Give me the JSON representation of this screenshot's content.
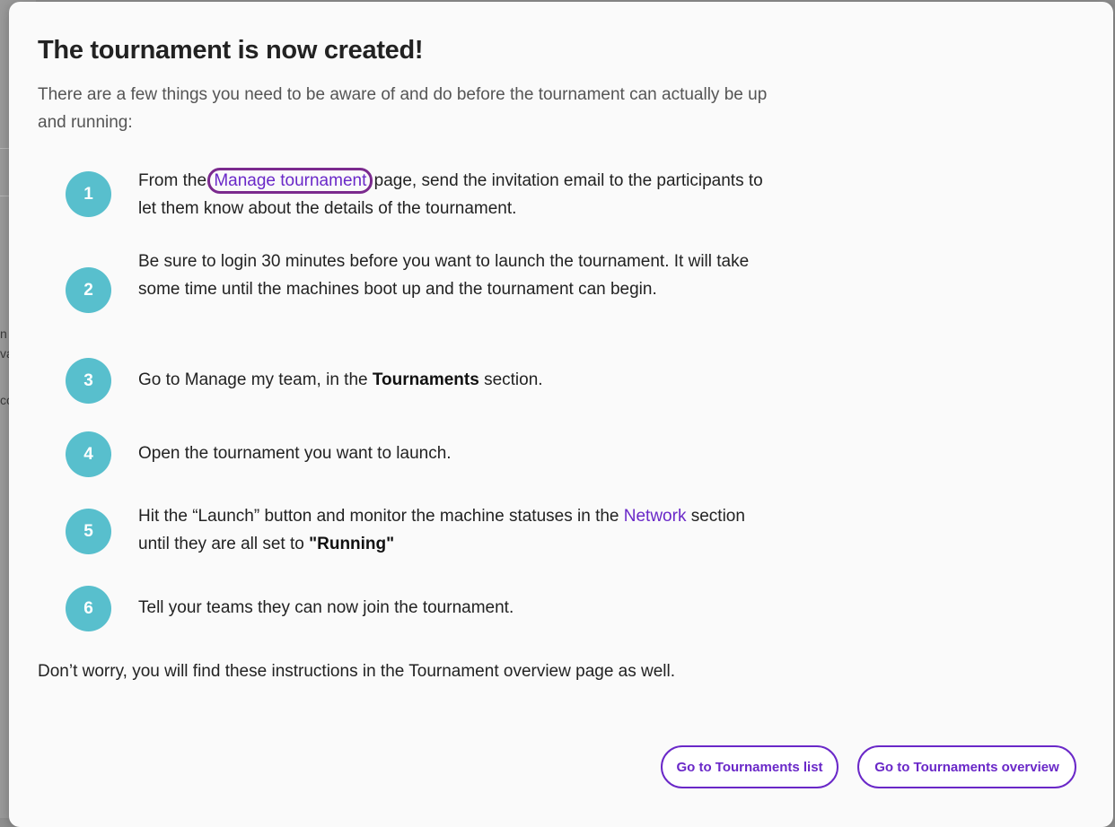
{
  "background": {
    "fragments": [
      "n",
      "va",
      "co"
    ]
  },
  "modal": {
    "title": "The tournament is now created!",
    "intro": "There are a few things you need to be aware of and do before the tournament can actually be up and running:",
    "steps": [
      {
        "number": "1",
        "before": "From the ",
        "link": "Manage tournament",
        "after": " page, send the invitation email to the participants to let them know about the details of the tournament."
      },
      {
        "number": "2",
        "text": "Be sure to login 30 minutes before you want to launch the tournament. It will take some time until the machines boot up and the tournament can begin."
      },
      {
        "number": "3",
        "before": "Go to Manage my team, in the ",
        "bold": "Tournaments",
        "after": " section."
      },
      {
        "number": "4",
        "text": "Open the tournament you want to launch."
      },
      {
        "number": "5",
        "before": "Hit the “Launch” button and monitor the machine statuses in the ",
        "link": "Network",
        "middle": " section until they are all set to ",
        "bold": "\"Running\""
      },
      {
        "number": "6",
        "text": "Tell your teams they can now join the tournament."
      }
    ],
    "footer": "Don’t worry, you will find these instructions in the Tournament overview page as well.",
    "buttons": {
      "list_label": "Go to Tournaments list",
      "overview_label": "Go to Tournaments overview"
    }
  },
  "colors": {
    "accent": "#6a28c8",
    "step_circle": "#58bfcd",
    "highlight_ring": "#7b2a8e"
  }
}
